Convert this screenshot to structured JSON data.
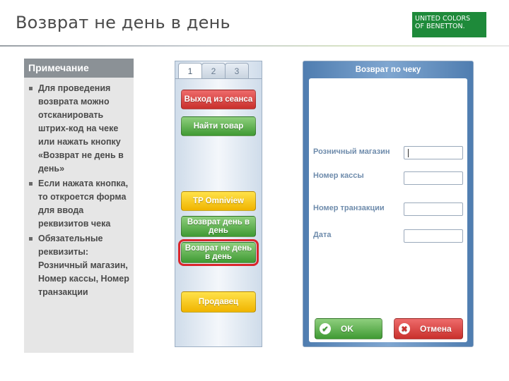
{
  "slide": {
    "title": "Возврат не день в день",
    "logo_line1": "UNITED COLORS",
    "logo_line2": "OF BENETTON."
  },
  "note": {
    "heading": "Примечание",
    "items": [
      "Для проведения возврата можно отсканировать штрих-код на чеке или нажать кнопку «Возврат не день в день»",
      "Если нажата кнопка, то откроется форма для ввода реквизитов чека",
      "Обязательные реквизиты: Розничный магазин, Номер кассы, Номер транзакции"
    ]
  },
  "pos_panel": {
    "tabs": [
      "1",
      "2",
      "3"
    ],
    "active_tab": "1",
    "buttons": {
      "logout": "Выход из сеанса",
      "find_item": "Найти товар",
      "omniview": "TP Omniview",
      "same_day_return": "Возврат день в день",
      "not_same_day_return": "Возврат не день в день",
      "seller": "Продавец"
    },
    "colors": {
      "red": "#c9302c",
      "green": "#3f9a33",
      "yellow": "#f0b400",
      "highlight": "#d9262c"
    }
  },
  "dialog": {
    "title": "Возврат по чеку",
    "fields": {
      "store": {
        "label": "Розничный магазин",
        "value": ""
      },
      "register": {
        "label": "Номер кассы",
        "value": ""
      },
      "transaction": {
        "label": "Номер транзакции",
        "value": ""
      },
      "date": {
        "label": "Дата",
        "value": ""
      }
    },
    "ok_label": "OK",
    "cancel_label": "Отмена"
  }
}
